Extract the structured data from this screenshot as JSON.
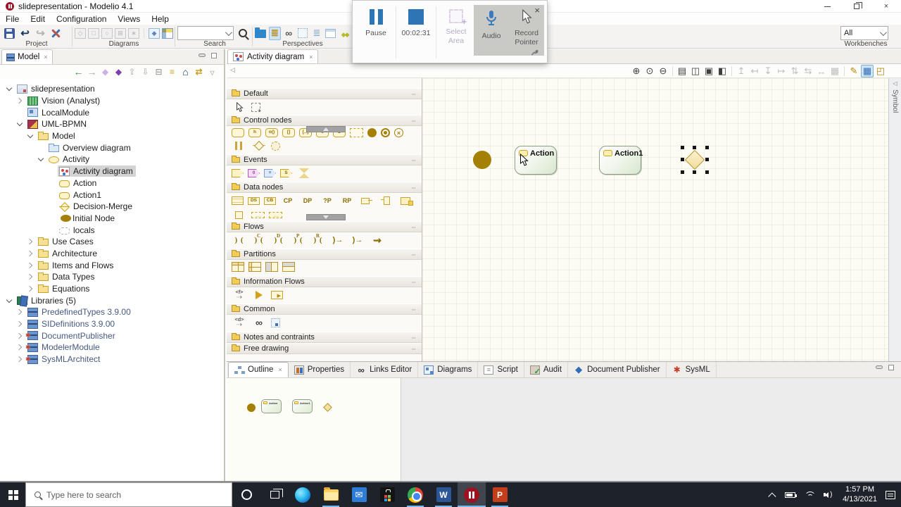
{
  "window": {
    "title": "slidepresentation - Modelio 4.1"
  },
  "menu": {
    "items": [
      "File",
      "Edit",
      "Configuration",
      "Views",
      "Help"
    ]
  },
  "toolbar": {
    "groups": [
      {
        "label": "Project",
        "icons": [
          "save",
          "back",
          "forward",
          "configure"
        ]
      },
      {
        "label": "Diagrams",
        "icons": []
      },
      {
        "label": "Search",
        "search_value": ""
      },
      {
        "label": "Perspectives",
        "icons": []
      }
    ],
    "diagram_icons": [
      {
        "n": "package-diagram",
        "g": "◇"
      },
      {
        "n": "bpmn-diagram",
        "g": "□"
      },
      {
        "n": "usecase-diagram",
        "g": "○"
      },
      {
        "n": "composite-diagram",
        "g": "⊞"
      },
      {
        "n": "actor-diagram",
        "g": "∗"
      },
      {
        "n": "sep",
        "g": ""
      },
      {
        "n": "auto-diagram",
        "g": "◆"
      },
      {
        "n": "matrix",
        "g": ""
      }
    ],
    "perspective_icons": [
      "new-project-folder",
      "model-explorer",
      "impact-links",
      "diagram",
      "hierarchy",
      "module-catalog",
      "bpmn-cluster"
    ],
    "workbenches": {
      "value": "All",
      "label": "Workbenches"
    }
  },
  "recorder": {
    "pause_label": "Pause",
    "stop_time": "00:02:31",
    "select_area_label": "Select Area",
    "audio_label": "Audio",
    "record_pointer_label": "Record Pointer"
  },
  "model_panel": {
    "tab_label": "Model",
    "toolbar_icons": [
      "navigate-back",
      "navigate-forward",
      "prev-element",
      "next-element",
      "move-up",
      "move-down",
      "collapse-all",
      "flat-hierarchy",
      "home",
      "sync-tree",
      "view-menu"
    ],
    "tree": [
      {
        "label": "slidepresentation",
        "depth": 0,
        "expander": "open",
        "icon": "project"
      },
      {
        "label": "Vision (Analyst)",
        "depth": 1,
        "expander": "closed",
        "icon": "vision"
      },
      {
        "label": "LocalModule",
        "depth": 1,
        "expander": "none",
        "icon": "local-module"
      },
      {
        "label": "UML-BPMN",
        "depth": 1,
        "expander": "open",
        "icon": "uml-bpmn"
      },
      {
        "label": "Model",
        "depth": 2,
        "expander": "open",
        "icon": "folder"
      },
      {
        "label": "Overview diagram",
        "depth": 3,
        "expander": "none",
        "icon": "overview-diagram"
      },
      {
        "label": "Activity",
        "depth": 3,
        "expander": "open",
        "icon": "activity"
      },
      {
        "label": "Activity diagram",
        "depth": 4,
        "expander": "none",
        "icon": "activity-diagram",
        "selected": true
      },
      {
        "label": "Action",
        "depth": 4,
        "expander": "none",
        "icon": "action"
      },
      {
        "label": "Action1",
        "depth": 4,
        "expander": "none",
        "icon": "action"
      },
      {
        "label": "Decision-Merge",
        "depth": 4,
        "expander": "none",
        "icon": "decision"
      },
      {
        "label": "Initial Node",
        "depth": 4,
        "expander": "none",
        "icon": "initial"
      },
      {
        "label": "locals",
        "depth": 4,
        "expander": "none",
        "icon": "locals"
      },
      {
        "label": "Use Cases",
        "depth": 2,
        "expander": "closed",
        "icon": "folder"
      },
      {
        "label": "Architecture",
        "depth": 2,
        "expander": "closed",
        "icon": "folder"
      },
      {
        "label": "Items and Flows",
        "depth": 2,
        "expander": "closed",
        "icon": "folder"
      },
      {
        "label": "Data Types",
        "depth": 2,
        "expander": "closed",
        "icon": "folder"
      },
      {
        "label": "Equations",
        "depth": 2,
        "expander": "closed",
        "icon": "folder"
      },
      {
        "label": "Libraries (5)",
        "depth": 0,
        "expander": "open",
        "icon": "libraries"
      },
      {
        "label": "PredefinedTypes 3.9.00",
        "depth": 1,
        "expander": "closed",
        "icon": "module-lib",
        "muted": true
      },
      {
        "label": "SIDefinitions 3.9.00",
        "depth": 1,
        "expander": "closed",
        "icon": "module-lib",
        "muted": true
      },
      {
        "label": "DocumentPublisher",
        "depth": 1,
        "expander": "closed",
        "icon": "module-star",
        "muted": true
      },
      {
        "label": "ModelerModule",
        "depth": 1,
        "expander": "closed",
        "icon": "module-star",
        "muted": true
      },
      {
        "label": "SysMLArchitect",
        "depth": 1,
        "expander": "closed",
        "icon": "module-star",
        "muted": true
      }
    ]
  },
  "editor": {
    "tab_label": "Activity diagram",
    "symbol_tab_label": "Symbol",
    "diagram_toolbar": [
      {
        "n": "zoom-in",
        "g": "⊕"
      },
      {
        "n": "zoom-original",
        "g": "⊙"
      },
      {
        "n": "zoom-out",
        "g": "⊖"
      },
      {
        "n": "sep"
      },
      {
        "n": "print",
        "g": "▤"
      },
      {
        "n": "save-image",
        "g": "◫"
      },
      {
        "n": "screenshot",
        "g": "▣"
      },
      {
        "n": "select-visible",
        "g": "◧"
      },
      {
        "n": "sep"
      },
      {
        "n": "align-top",
        "g": "↥",
        "s": "d"
      },
      {
        "n": "align-left",
        "g": "↤",
        "s": "d"
      },
      {
        "n": "align-bottom",
        "g": "↧",
        "s": "d"
      },
      {
        "n": "align-right",
        "g": "↦",
        "s": "d"
      },
      {
        "n": "distribute-v",
        "g": "⇅",
        "s": "d"
      },
      {
        "n": "distribute-h",
        "g": "⇆",
        "s": "d"
      },
      {
        "n": "same-size",
        "g": "↔",
        "s": "d"
      },
      {
        "n": "snap-grid",
        "g": "▦",
        "s": "d"
      },
      {
        "n": "sep"
      },
      {
        "n": "style-edit",
        "g": "✎",
        "s": "g"
      },
      {
        "n": "grid-toggle",
        "g": "▦",
        "s": "a"
      },
      {
        "n": "page-layout",
        "g": "◰",
        "s": "g"
      }
    ],
    "palette": {
      "sections": [
        {
          "name": "Default",
          "icons": [
            {
              "n": "selection-tool",
              "k": "cursor"
            },
            {
              "n": "marquee-zoom-tool",
              "k": "marquee"
            }
          ]
        },
        {
          "name": "Control nodes",
          "icons": [
            {
              "n": "action",
              "k": "anode",
              "g": ""
            },
            {
              "n": "call-behavior-action",
              "k": "anode",
              "g": "h"
            },
            {
              "n": "call-operation-action",
              "k": "anode",
              "g": "o()"
            },
            {
              "n": "opaque-action",
              "k": "anode",
              "g": "[]"
            },
            {
              "n": "accept-call-action",
              "k": "anode",
              "g": "[‥]"
            },
            {
              "n": "accept-time-action",
              "k": "anode",
              "g": "↻"
            },
            {
              "n": "send-signal-action",
              "k": "anode",
              "g": "S"
            },
            {
              "n": "structured-activity-node",
              "k": "dashedrect"
            },
            {
              "n": "initial-node",
              "k": "dotfill"
            },
            {
              "n": "activity-final-node",
              "k": "ringdot"
            },
            {
              "n": "flow-final-node",
              "k": "circlex"
            },
            {
              "n": "fork-join-node",
              "k": "fork"
            },
            {
              "n": "decision-merge-node",
              "k": "decision"
            },
            {
              "n": "interruptible-region",
              "k": "dashedcircle"
            }
          ]
        },
        {
          "name": "Events",
          "icons": [
            {
              "n": "signal-event",
              "k": "flag",
              "c": "y",
              "g": ""
            },
            {
              "n": "time-event",
              "k": "flag",
              "c": "p",
              "g": "0"
            },
            {
              "n": "change-event",
              "k": "flag",
              "c": "b",
              "g": "≡"
            },
            {
              "n": "send-event",
              "k": "flag",
              "c": "y",
              "g": "S"
            },
            {
              "n": "timer-event",
              "k": "hourglass"
            }
          ]
        },
        {
          "name": "Data nodes",
          "icons": [
            {
              "n": "object-node",
              "k": "rectlines"
            },
            {
              "n": "datastore-node",
              "k": "tag",
              "g": "DS"
            },
            {
              "n": "central-buffer-node",
              "k": "tag",
              "g": "CB"
            },
            {
              "n": "cp-pin",
              "k": "txt",
              "g": "CP"
            },
            {
              "n": "dp-pin",
              "k": "txt",
              "g": "DP"
            },
            {
              "n": "qp-pin",
              "k": "txt",
              "g": "?P"
            },
            {
              "n": "rp-pin",
              "k": "txt",
              "g": "RP"
            },
            {
              "n": "input-pin",
              "k": "pinh"
            },
            {
              "n": "output-pin",
              "k": "pinv"
            },
            {
              "n": "value-pin",
              "k": "pinr"
            },
            {
              "n": "parameter-node",
              "k": "pinsq"
            },
            {
              "n": "expansion-node-in",
              "k": "minidash"
            },
            {
              "n": "expansion-node-out",
              "k": "minidash2"
            }
          ]
        },
        {
          "name": "Flows",
          "icons": [
            {
              "n": "control-flow",
              "k": "flow",
              "g": ""
            },
            {
              "n": "control-flow-c",
              "k": "flow",
              "g": "C"
            },
            {
              "n": "control-flow-d",
              "k": "flow",
              "g": "D"
            },
            {
              "n": "control-flow-p",
              "k": "flow",
              "g": "P"
            },
            {
              "n": "control-flow-r",
              "k": "flow",
              "g": "R"
            },
            {
              "n": "object-flow",
              "k": "flowarrowblue"
            },
            {
              "n": "flow-arrow",
              "k": "flowarrow"
            },
            {
              "n": "dependency-flow",
              "k": "zigzag"
            }
          ]
        },
        {
          "name": "Partitions",
          "icons": [
            {
              "n": "vertical-partition",
              "k": "partv"
            },
            {
              "n": "horizontal-partition",
              "k": "parth"
            },
            {
              "n": "vertical-partition-container",
              "k": "partvg"
            },
            {
              "n": "horizontal-partition-container",
              "k": "parthg"
            }
          ]
        },
        {
          "name": "Information Flows",
          "icons": [
            {
              "n": "information-flow",
              "k": "tagarrow",
              "g": "<f>"
            },
            {
              "n": "information-flow-realized",
              "k": "tri"
            },
            {
              "n": "information-item",
              "k": "rectarrow"
            }
          ]
        },
        {
          "name": "Common",
          "icons": [
            {
              "n": "dependency",
              "k": "tagarrow",
              "g": "<d>"
            },
            {
              "n": "related-diagram-link",
              "k": "chain"
            },
            {
              "n": "drawing-zone",
              "k": "dottedsq"
            }
          ]
        },
        {
          "name": "Notes and contraints",
          "icons": []
        },
        {
          "name": "Free drawing",
          "icons": []
        }
      ]
    },
    "canvas": {
      "nodes": [
        {
          "type": "initial-node"
        },
        {
          "type": "action",
          "label": "Action"
        },
        {
          "type": "action",
          "label": "Action1"
        },
        {
          "type": "decision-merge",
          "selected": true
        }
      ]
    }
  },
  "bottom_panel": {
    "tabs": [
      {
        "label": "Outline",
        "icon": "outline",
        "active": true,
        "closable": true
      },
      {
        "label": "Properties",
        "icon": "properties"
      },
      {
        "label": "Links Editor",
        "icon": "links"
      },
      {
        "label": "Diagrams",
        "icon": "diagrams"
      },
      {
        "label": "Script",
        "icon": "script"
      },
      {
        "label": "Audit",
        "icon": "audit"
      },
      {
        "label": "Document Publisher",
        "icon": "docpub"
      },
      {
        "label": "SysML",
        "icon": "sysml"
      }
    ]
  },
  "taskbar": {
    "search_placeholder": "Type here to search",
    "apps": [
      "cortana",
      "taskview",
      "edge",
      "file-explorer",
      "mail",
      "store",
      "chrome",
      "word",
      "modelio",
      "powerpoint"
    ],
    "underlined": [
      "file-explorer",
      "chrome",
      "word",
      "modelio",
      "powerpoint"
    ],
    "active": "modelio",
    "clock_time": "1:57 PM",
    "clock_date": "4/13/2021"
  }
}
